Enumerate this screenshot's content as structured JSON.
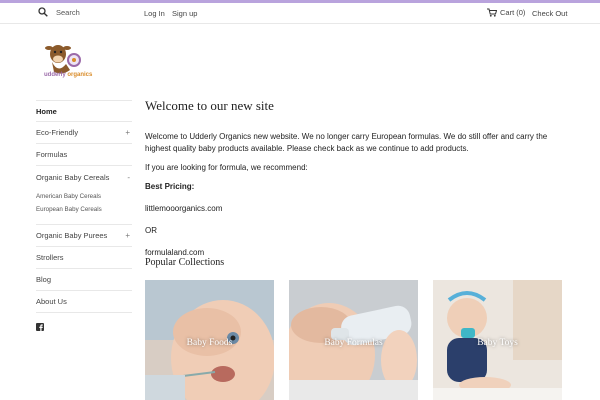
{
  "header": {
    "search_placeholder": "Search",
    "login": "Log In",
    "signup": "Sign up",
    "cart": "Cart (0)",
    "checkout": "Check Out"
  },
  "logo": {
    "udderly": "udderly",
    "organics": "organics"
  },
  "sidebar": {
    "home": "Home",
    "eco": "Eco-Friendly",
    "formulas": "Formulas",
    "cereals": "Organic Baby Cereals",
    "cereals_sub": [
      "American Baby Cereals",
      "European Baby Cereals"
    ],
    "purees": "Organic Baby Purees",
    "strollers": "Strollers",
    "blog": "Blog",
    "about": "About Us",
    "plus": "+",
    "minus": "-"
  },
  "main": {
    "title": "Welcome to our new site",
    "p1": "Welcome to Udderly Organics new website.  We no longer carry European formulas.  We do still offer and carry the highest quality baby products available.  Please check back as we continue to add products.",
    "p2": "If you are looking for formula, we recommend:",
    "best": "Best Pricing:",
    "link1": "littlemooorganics.com",
    "or": "OR",
    "link2": "formulaland.com"
  },
  "collections": {
    "title": "Popular Collections",
    "items": [
      "Baby Foods",
      "Baby Formulas",
      "Baby Toys"
    ]
  },
  "colors": {
    "accent": "#b9a3dd",
    "brand_purple": "#9b6aa9",
    "brand_orange": "#d98c2a"
  }
}
